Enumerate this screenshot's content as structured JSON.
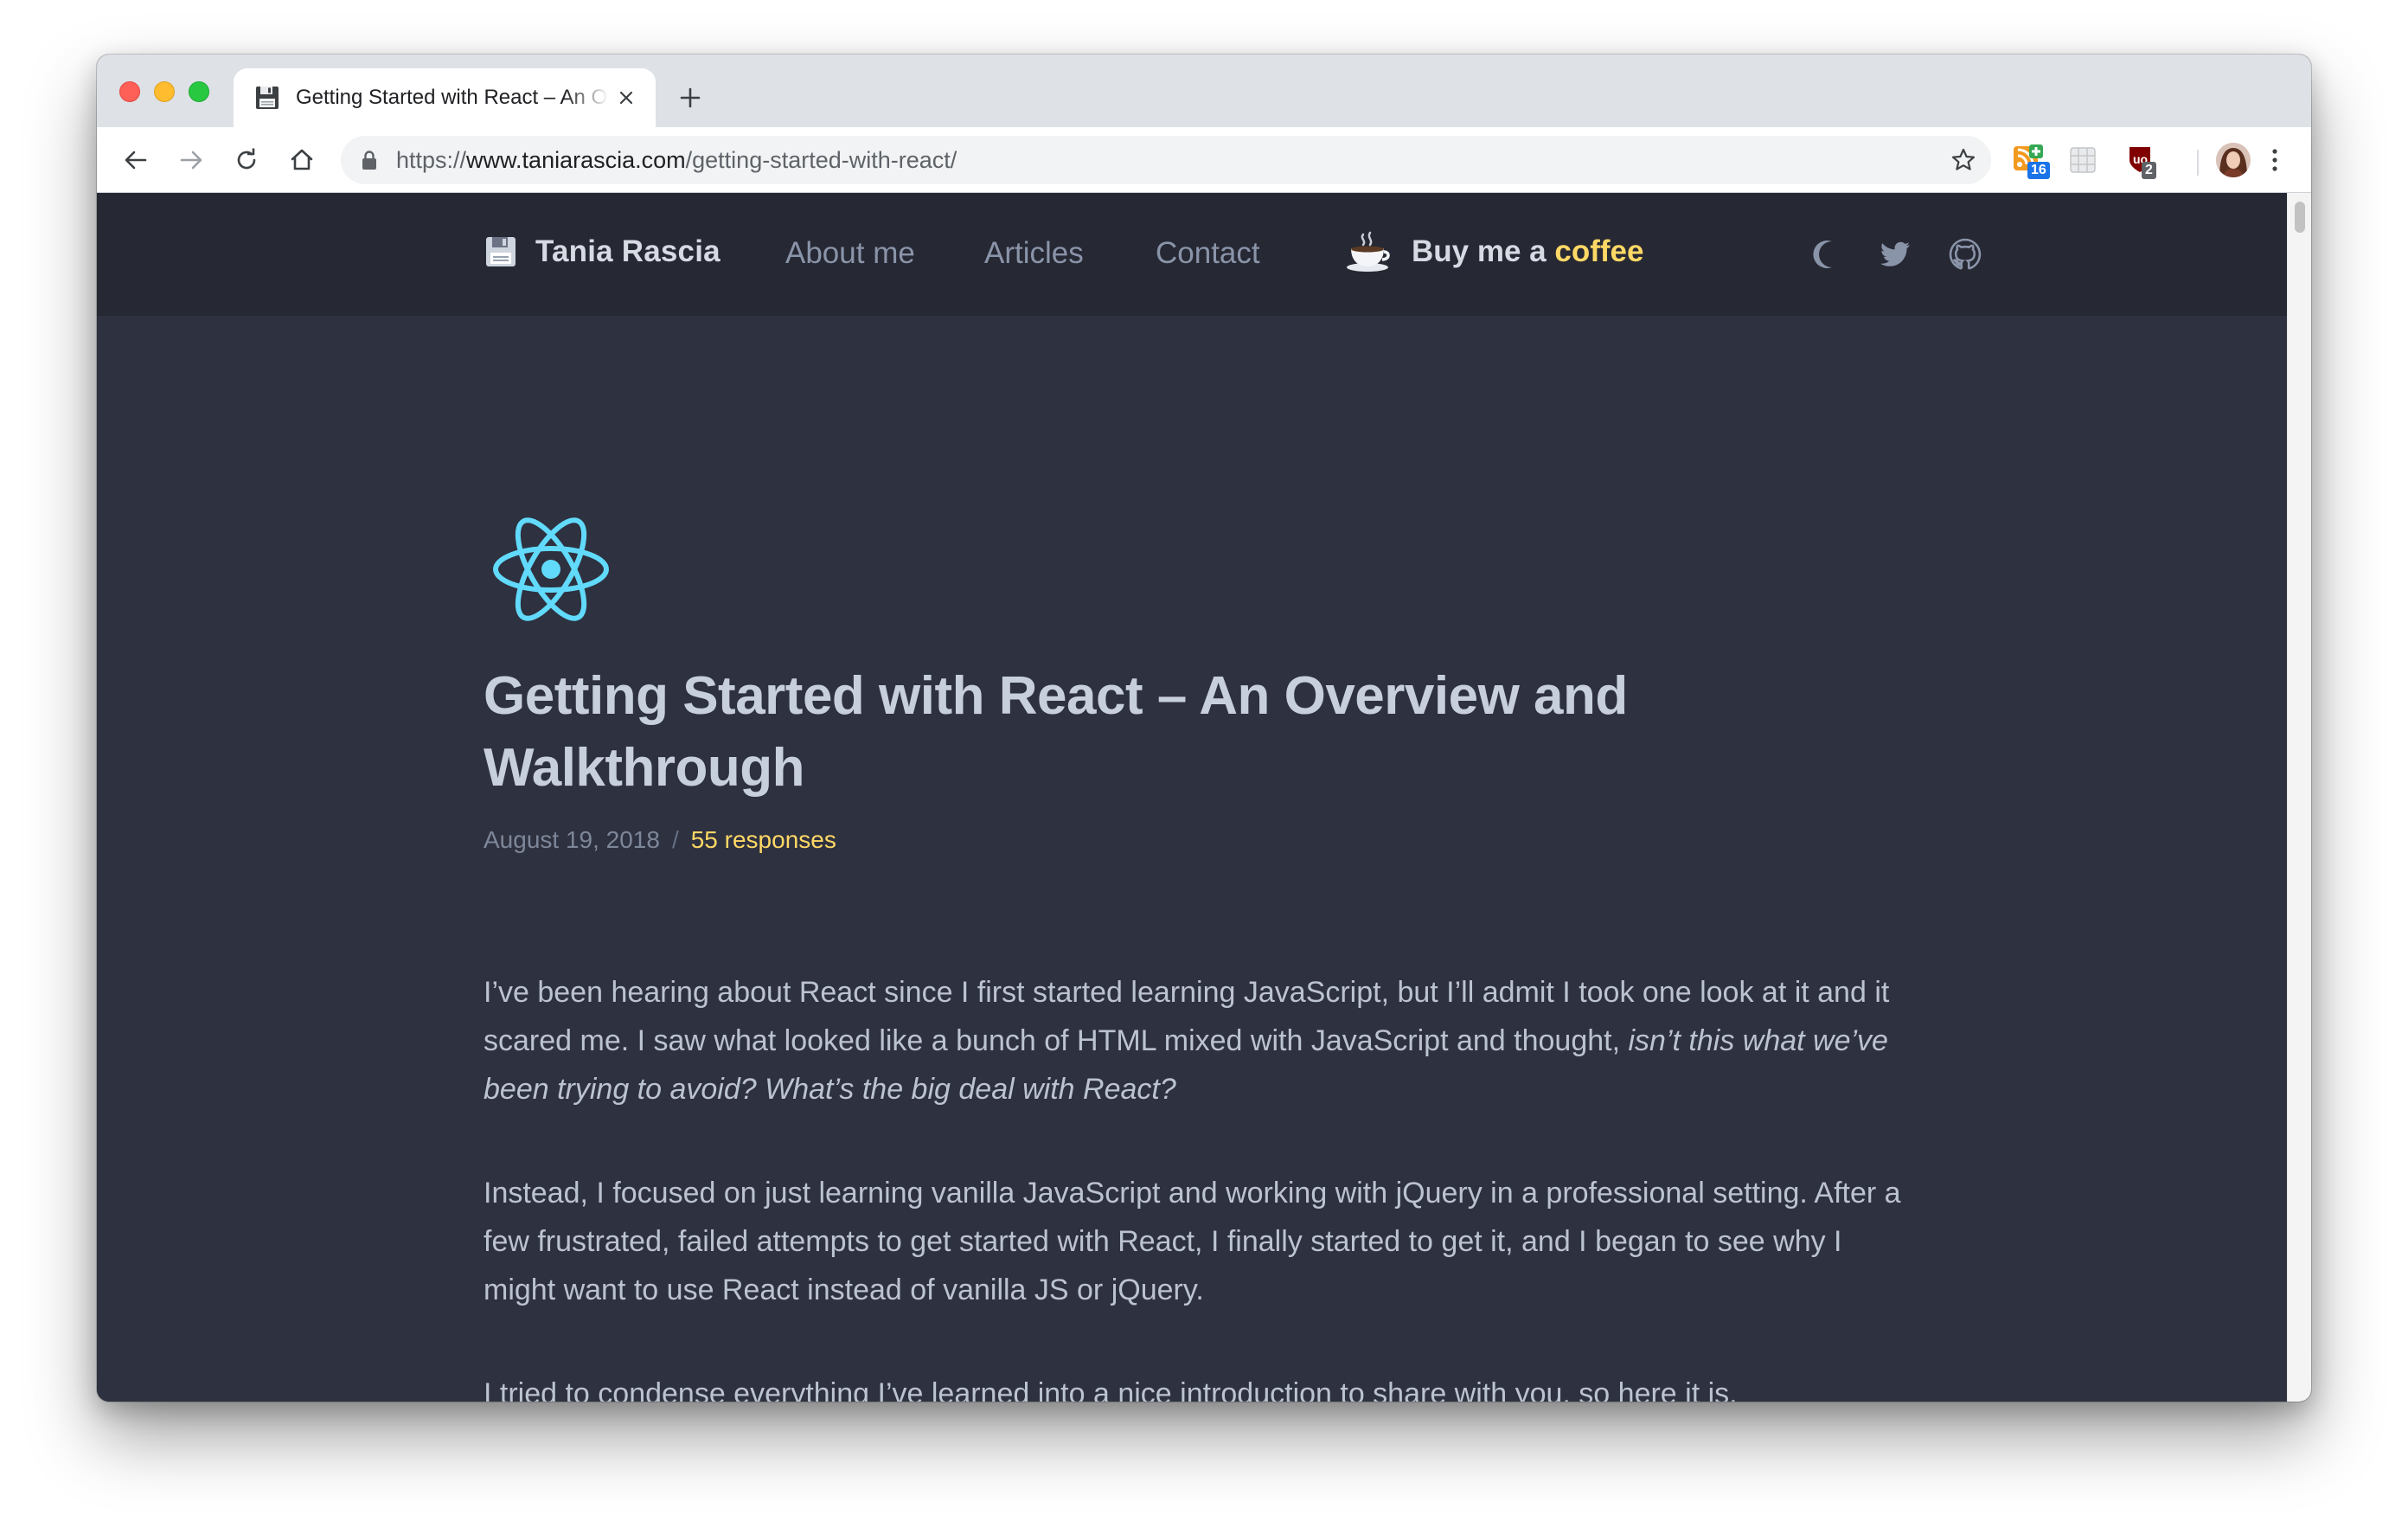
{
  "browser": {
    "tab": {
      "title": "Getting Started with React – An Overview and Walkthrough"
    },
    "address_bar": {
      "scheme": "https://",
      "host": "www.taniarascia.com",
      "path": "/getting-started-with-react/"
    },
    "extensions": [
      {
        "icon": "rss-plus-icon",
        "badge": "16",
        "badge_color": "#1a73e8"
      },
      {
        "icon": "grid-extension-icon",
        "badge": ""
      },
      {
        "icon": "ublock-shield-icon",
        "badge": "2",
        "badge_color": "#5f6368"
      }
    ]
  },
  "site": {
    "brand": "Tania Rascia",
    "nav": {
      "about": "About me",
      "articles": "Articles",
      "contact": "Contact"
    },
    "coffee": {
      "prefix": "Buy me a",
      "accent": "coffee"
    },
    "icons": [
      "moon-icon",
      "twitter-icon",
      "github-icon"
    ]
  },
  "post": {
    "title": "Getting Started with React – An Overview and Walkthrough",
    "date": "August 19, 2018",
    "separator": "/",
    "responses": "55 responses",
    "paragraphs": {
      "p1_text": "I’ve been hearing about React since I first started learning JavaScript, but I’ll admit I took one look at it and it scared me. I saw what looked like a bunch of HTML mixed with JavaScript and thought, ",
      "p1_italic": "isn’t this what we’ve been trying to avoid? What’s the big deal with React?",
      "p2": "Instead, I focused on just learning vanilla JavaScript and working with jQuery in a professional setting. After a few frustrated, failed attempts to get started with React, I finally started to get it, and I began to see why I might want to use React instead of vanilla JS or jQuery.",
      "p3": "I tried to condense everything I’ve learned into a nice introduction to share with you, so here it is."
    }
  },
  "colors": {
    "page_bg": "#2e313f",
    "nav_bg": "#262833",
    "accent_yellow": "#ffd866",
    "react_cyan": "#61dafb"
  }
}
